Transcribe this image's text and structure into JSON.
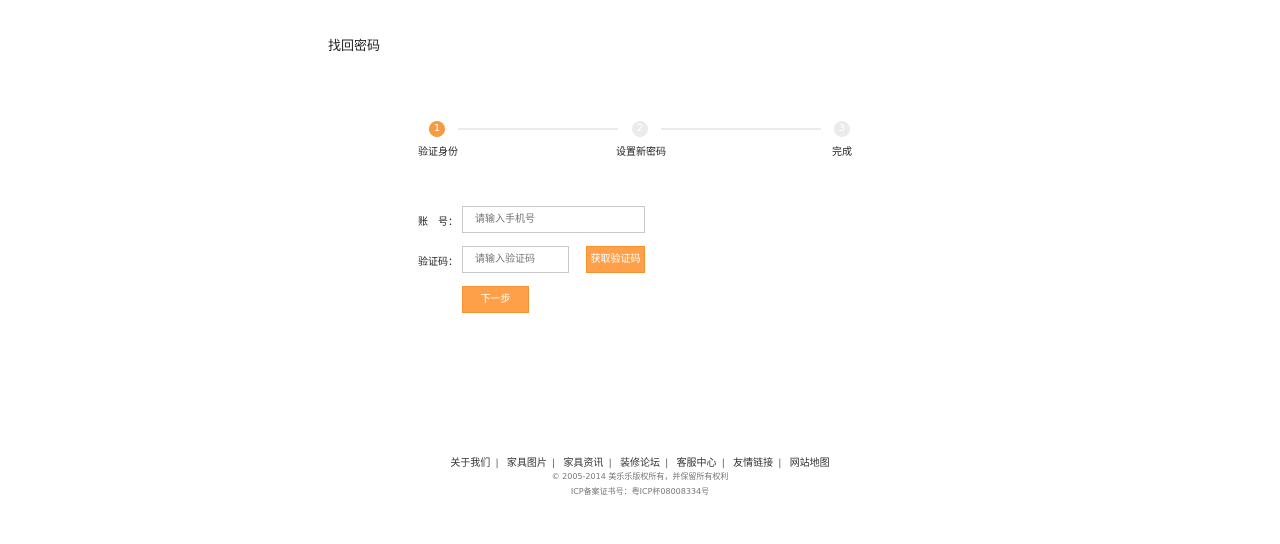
{
  "page_title": "找回密码",
  "steps": [
    {
      "num": "1",
      "label": "验证身份",
      "active": true
    },
    {
      "num": "2",
      "label": "设置新密码",
      "active": false
    },
    {
      "num": "3",
      "label": "完成",
      "active": false
    }
  ],
  "form": {
    "account_label": "账　号：",
    "account_placeholder": "请输入手机号",
    "code_label": "验证码：",
    "code_placeholder": "请输入验证码",
    "get_code_button": "获取验证码",
    "next_button": "下一步"
  },
  "footer": {
    "links": [
      "关于我们",
      "家具图片",
      "家具资讯",
      "装修论坛",
      "客服中心",
      "友情链接",
      "网站地图"
    ],
    "copyright": "© 2005-2014 美乐乐版权所有，并保留所有权利",
    "icp": "ICP备案证书号：粤ICP杯08008334号"
  },
  "colors": {
    "accent": "#fea04a"
  }
}
